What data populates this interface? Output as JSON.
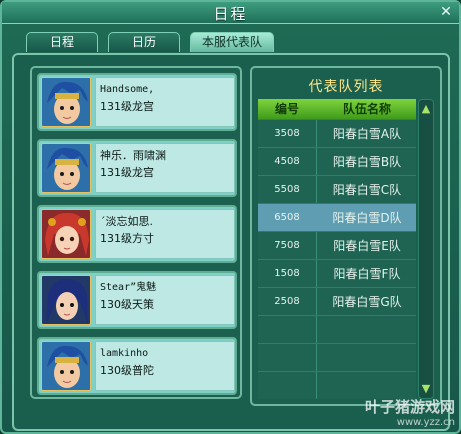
{
  "window": {
    "title": "日程",
    "close_glyph": "✕"
  },
  "tabs": [
    {
      "label": "日程"
    },
    {
      "label": "日历"
    },
    {
      "label": "本服代表队"
    }
  ],
  "members": [
    {
      "name": "Handsome,",
      "desc": "131级龙宫",
      "avatar": "blue-hair-boy"
    },
    {
      "name": "神乐．雨啸渊",
      "desc": "131级龙宫",
      "avatar": "blue-hair-boy"
    },
    {
      "name": "ˊ淡忘如思.",
      "desc": "131级方寸",
      "avatar": "red-hair-girl"
    },
    {
      "name": "Stear”鬼魅",
      "desc": "130级天策",
      "avatar": "dark-blue-hair-girl"
    },
    {
      "name": "lamkinho",
      "desc": "130级普陀",
      "avatar": "blue-hair-boy"
    }
  ],
  "teams": {
    "title": "代表队列表",
    "columns": [
      "编号",
      "队伍名称"
    ],
    "rows": [
      {
        "id": "3508",
        "name": "阳春白雪A队"
      },
      {
        "id": "4508",
        "name": "阳春白雪B队"
      },
      {
        "id": "5508",
        "name": "阳春白雪C队"
      },
      {
        "id": "6508",
        "name": "阳春白雪D队"
      },
      {
        "id": "7508",
        "name": "阳春白雪E队"
      },
      {
        "id": "1508",
        "name": "阳春白雪F队"
      },
      {
        "id": "2508",
        "name": "阳春白雪G队"
      }
    ],
    "selected_row": 3
  },
  "watermark": {
    "title": "叶子猪游戏网",
    "url": "www.yzz.cn"
  }
}
